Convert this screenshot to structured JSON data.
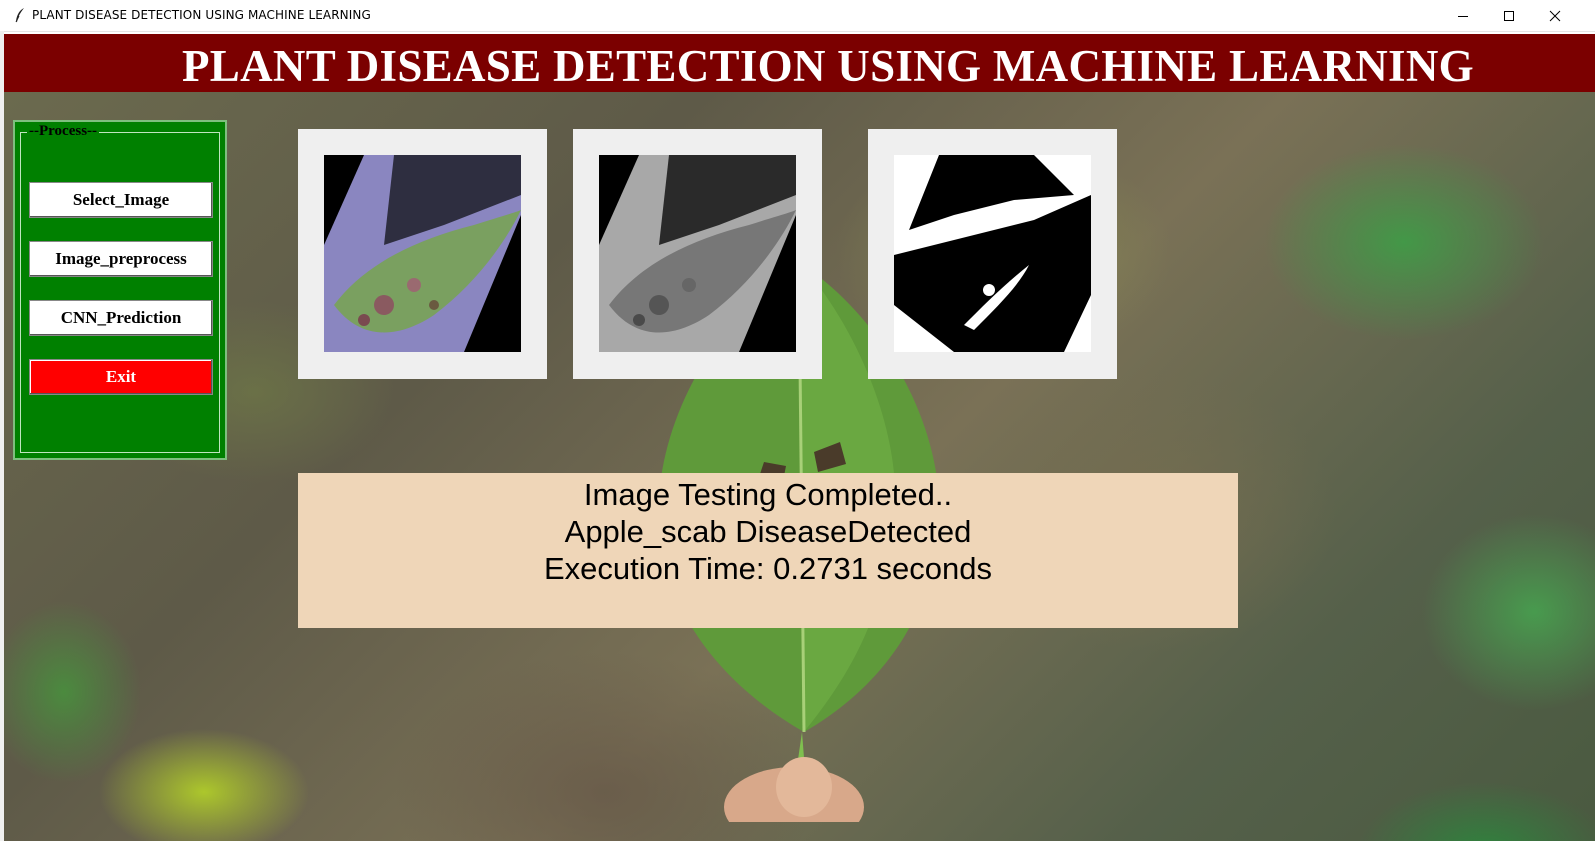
{
  "window": {
    "title": "PLANT DISEASE DETECTION USING MACHINE LEARNING",
    "icon": "feather-icon",
    "controls": [
      "minimize-icon",
      "maximize-icon",
      "close-icon"
    ]
  },
  "banner": {
    "title": "PLANT DISEASE DETECTION USING MACHINE LEARNING",
    "color": "#7b0000"
  },
  "process_panel": {
    "legend": "--Process--",
    "color": "#008000",
    "buttons": [
      {
        "label": "Select_Image"
      },
      {
        "label": "Image_preprocess"
      },
      {
        "label": "CNN_Prediction"
      },
      {
        "label": "Exit",
        "color": "#ff0000"
      }
    ]
  },
  "images": [
    {
      "name": "original-leaf-image"
    },
    {
      "name": "grayscale-leaf-image"
    },
    {
      "name": "binary-threshold-image"
    }
  ],
  "result": {
    "line1": "Image Testing Completed..",
    "line2": "Apple_scab DiseaseDetected",
    "line3": "Execution Time: 0.2731 seconds",
    "color": "#efd6b8"
  }
}
